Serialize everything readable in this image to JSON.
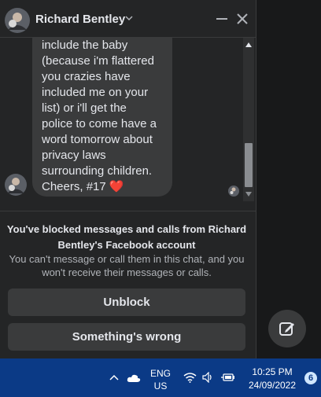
{
  "chat": {
    "contact_name": "Richard Bentley",
    "message_text": "include the baby\n(because i'm flattered\nyou crazies have\nincluded me on your\nlist) or i'll get the\npolice to come have a\nword tomorrow about\nprivacy laws\nsurrounding children.\nCheers, #17 ❤️"
  },
  "blocked": {
    "title": "You've blocked messages and calls from Richard Bentley's Facebook account",
    "description": "You can't message or call them in this chat, and you won't receive their messages or calls.",
    "unblock_label": "Unblock",
    "wrong_label": "Something's wrong"
  },
  "taskbar": {
    "language_line1": "ENG",
    "language_line2": "US",
    "time": "10:25 PM",
    "date": "24/09/2022",
    "notification_count": "6"
  },
  "icons": {
    "header": [
      "avatar",
      "chevron-down-icon",
      "minimize-icon",
      "close-icon"
    ],
    "tray": [
      "chevron-up-icon",
      "onedrive-cloud-icon",
      "wifi-icon",
      "speaker-icon",
      "battery-icon"
    ],
    "compose": "compose-icon"
  },
  "colors": {
    "panel_bg": "#242526",
    "bubble_bg": "#3a3b3c",
    "text_primary": "#e4e6eb",
    "text_secondary": "#b0b3b8",
    "heart": "#f02849",
    "taskbar_bg": "#0b3a86"
  }
}
